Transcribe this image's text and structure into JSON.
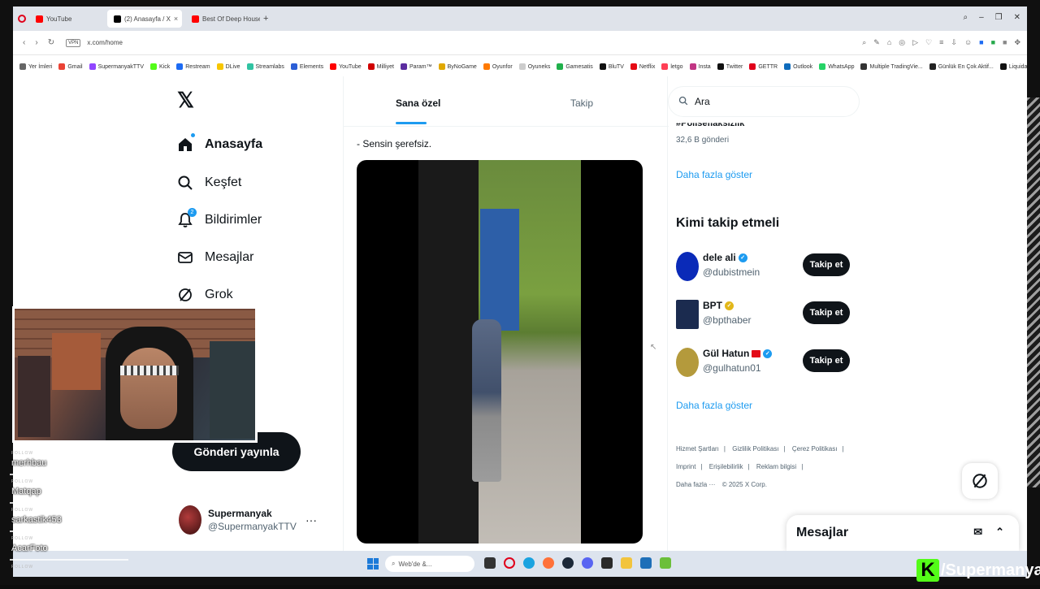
{
  "browser": {
    "tabs": [
      {
        "label": "YouTube",
        "color": "#ff0000",
        "active": false
      },
      {
        "label": "(2) Anasayfa / X",
        "color": "#000000",
        "active": true
      },
      {
        "label": "Best Of Deep House M",
        "color": "#ff0000",
        "active": false
      }
    ],
    "url": "x.com/home",
    "vpn_label": "VPN",
    "bookmarks": [
      {
        "label": "Yer İmleri",
        "color": "#666666"
      },
      {
        "label": "Gmail",
        "color": "#ea4335"
      },
      {
        "label": "SupermanyakTTV",
        "color": "#9146ff"
      },
      {
        "label": "Kick",
        "color": "#53fc18"
      },
      {
        "label": "Restream",
        "color": "#1d6bf3"
      },
      {
        "label": "DLive",
        "color": "#f7c600"
      },
      {
        "label": "Streamlabs",
        "color": "#31c3a2"
      },
      {
        "label": "Elements",
        "color": "#2b5ed6"
      },
      {
        "label": "YouTube",
        "color": "#ff0000"
      },
      {
        "label": "Milliyet",
        "color": "#d00000"
      },
      {
        "label": "Param™",
        "color": "#5b2ca0"
      },
      {
        "label": "ByNoGame",
        "color": "#e0a800"
      },
      {
        "label": "Oyunfor",
        "color": "#ff7a00"
      },
      {
        "label": "Oyuneks",
        "color": "#cccccc"
      },
      {
        "label": "Gamesatis",
        "color": "#20b04b"
      },
      {
        "label": "BluTV",
        "color": "#111111"
      },
      {
        "label": "Netflix",
        "color": "#e50914"
      },
      {
        "label": "letgo",
        "color": "#ff3f55"
      },
      {
        "label": "Insta",
        "color": "#c13584"
      },
      {
        "label": "Twitter",
        "color": "#111111"
      },
      {
        "label": "GETTR",
        "color": "#e0001a"
      },
      {
        "label": "Outlook",
        "color": "#0f6cbd"
      },
      {
        "label": "WhatsApp",
        "color": "#25d366"
      },
      {
        "label": "Multiple TradingVie...",
        "color": "#333333"
      },
      {
        "label": "Günlük En Çok Aktif...",
        "color": "#222222"
      },
      {
        "label": "Liquidation Heatma...",
        "color": "#111111"
      }
    ]
  },
  "x_nav": {
    "items": [
      {
        "label": "Anasayfa",
        "icon": "home-icon"
      },
      {
        "label": "Keşfet",
        "icon": "search-icon"
      },
      {
        "label": "Bildirimler",
        "icon": "bell-icon",
        "badge": "2"
      },
      {
        "label": "Mesajlar",
        "icon": "mail-icon"
      },
      {
        "label": "Grok",
        "icon": "grok-icon"
      }
    ],
    "post_button": "Gönderi yayınla",
    "profile": {
      "name": "Supermanyak",
      "handle": "@SupermanyakTTV"
    }
  },
  "feed": {
    "tabs": [
      {
        "label": "Sana özel"
      },
      {
        "label": "Takip"
      }
    ],
    "tweet_text": "- Sensin şerefsiz."
  },
  "sidebar": {
    "search_placeholder": "Ara",
    "trend": {
      "name": "#Polisefiaksizlik",
      "count": "32,6 B gönderi"
    },
    "show_more": "Daha fazla göster",
    "who_to_follow_title": "Kimi takip etmeli",
    "suggestions": [
      {
        "name": "dele ali",
        "handle": "@dubistmein",
        "badge_color": "#1d9bf0",
        "avatar_color": "#0a2ab8"
      },
      {
        "name": "BPT",
        "handle": "@bpthaber",
        "badge_color": "#e2b719",
        "avatar_color": "#1b2b4f"
      },
      {
        "name": "Gül Hatun",
        "handle": "@gulhatun01",
        "badge_color": "#1d9bf0",
        "avatar_color": "#b49a3c"
      }
    ],
    "follow_label": "Takip et",
    "show_more_2": "Daha fazla göster",
    "footer": [
      "Hizmet Şartları",
      "Gizlilik Politikası",
      "Çerez Politikası",
      "Imprint",
      "Erişilebilirlik",
      "Reklam bilgisi"
    ],
    "footer_more": "Daha fazla ···",
    "copyright": "© 2025 X Corp."
  },
  "messages_drawer": {
    "title": "Mesajlar"
  },
  "taskbar": {
    "search_label": "Web'de &..."
  },
  "chat": [
    {
      "tag": "FOLLOW",
      "name": "merhbau"
    },
    {
      "tag": "FOLLOW",
      "name": "Matqap"
    },
    {
      "tag": "FOLLOW",
      "name": "sarkastik453"
    },
    {
      "tag": "FOLLOW",
      "name": "AcarFoto"
    },
    {
      "tag": "FOLLOW",
      "name": ""
    }
  ],
  "brand": {
    "letter": "K",
    "name": "/Supermanyak"
  }
}
